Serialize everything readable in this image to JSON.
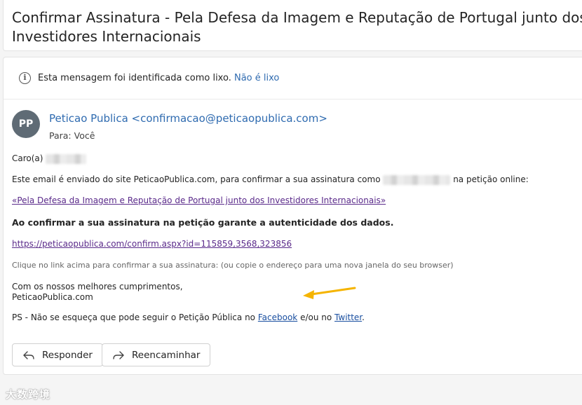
{
  "subject": "Confirmar Assinatura - Pela Defesa da Imagem e Reputação de Portugal junto dos Investidores Internacionais",
  "junk_bar": {
    "message": "Esta mensagem foi identificada como lixo.",
    "action": "Não é lixo"
  },
  "sender": {
    "initials": "PP",
    "display": "Peticao Publica <confirmacao@peticaopublica.com>",
    "to_label": "Para:",
    "to_value": "Você"
  },
  "body": {
    "greeting": "Caro(a)",
    "intro_before": "Este email é enviado do site PeticaoPublica.com, para confirmar a sua assinatura como",
    "intro_after": "na petição online:",
    "petition_link": "«Pela Defesa da Imagem e Reputação de Portugal junto dos Investidores Internacionais»",
    "bold_text": "Ao confirmar a sua assinatura na petição garante a autenticidade dos dados.",
    "confirm_link": "https://peticaopublica.com/confirm.aspx?id=115859,3568,323856",
    "note": "Clique no link acima para confirmar a sua assinatura: (ou copie o endereço para uma nova janela do seu browser)",
    "signoff_1": "Com os nossos melhores cumprimentos,",
    "signoff_2": "PeticaoPublica.com",
    "ps_before": "PS - Não se esqueça que pode seguir o Petição Pública no",
    "facebook": "Facebook",
    "ps_middle": "e/ou no",
    "twitter": "Twitter",
    "ps_end": "."
  },
  "actions": {
    "reply": "Responder",
    "forward": "Reencaminhar"
  },
  "watermark": "大数跨境",
  "colors": {
    "link_blue": "#2f6bb0",
    "visited_link": "#5a2a8a",
    "arrow": "#f5b400",
    "avatar_bg": "#5f6b75"
  }
}
